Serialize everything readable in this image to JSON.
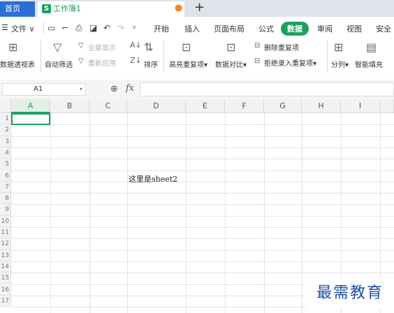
{
  "tabs": {
    "home": "首页",
    "workbook": "工作簿1",
    "add": "+"
  },
  "menu": {
    "file": "文件",
    "items": [
      "开始",
      "插入",
      "页面布局",
      "公式",
      "数据",
      "审阅",
      "视图",
      "安全"
    ],
    "active": "数据"
  },
  "ribbon": {
    "pivot": "数据透视表",
    "autofilter": "自动筛选",
    "show_all": "全部显示",
    "reapply": "重新应用",
    "sort": "排序",
    "highlight_dup": "高亮重复项",
    "compare": "数据对比",
    "remove_dup": "删除重复项",
    "reject_dup": "拒绝录入重复项",
    "split": "分列",
    "smart_fill": "智能填充"
  },
  "formula_bar": {
    "name_box": "A1",
    "fx": "fx",
    "value": ""
  },
  "grid": {
    "columns": [
      "A",
      "B",
      "C",
      "D",
      "E",
      "F",
      "G",
      "H",
      "I"
    ],
    "selected_column": "A",
    "rows": [
      "1",
      "2",
      "3",
      "4",
      "5",
      "6",
      "7",
      "8",
      "9",
      "10",
      "11",
      "12",
      "13",
      "14",
      "15",
      "16",
      "17"
    ],
    "cell_D6": "这里是sheet2"
  },
  "watermark": "最需教育",
  "colors": {
    "accent": "#1aa260",
    "home_tab": "#2b6fd6",
    "watermark": "#1e4ea8"
  }
}
